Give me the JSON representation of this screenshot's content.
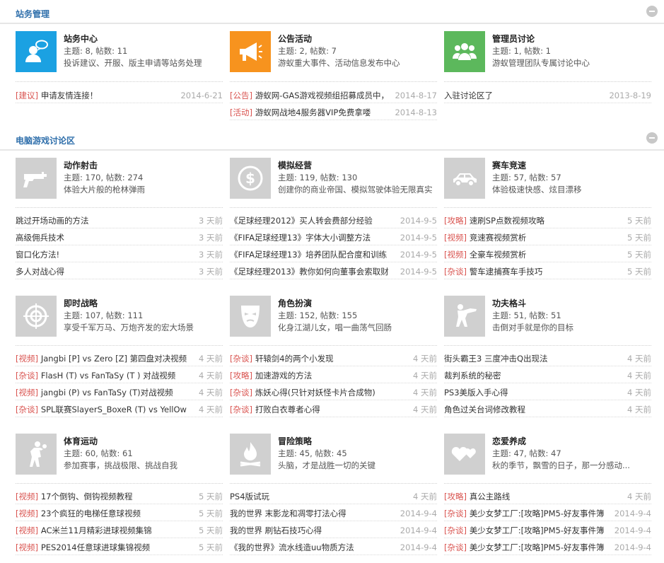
{
  "sections": [
    {
      "title": "站务管理"
    },
    {
      "title": "电脑游戏讨论区"
    }
  ],
  "forums": [
    {
      "name": "站务中心",
      "stats": "主题: 8, 帖数: 11",
      "desc": "投诉建议、开服、版主申请等站务处理",
      "icon": "user-chat-icon",
      "color": "#1ba1e2"
    },
    {
      "name": "公告活动",
      "stats": "主题: 2, 帖数: 7",
      "desc": "游蚁重大事件、活动信息发布中心",
      "icon": "megaphone-icon",
      "color": "#f7931e"
    },
    {
      "name": "管理员讨论",
      "stats": "主题: 1, 帖数: 1",
      "desc": "游蚁管理团队专属讨论中心",
      "icon": "group-icon",
      "color": "#5cb85c"
    },
    {
      "name": "动作射击",
      "stats": "主题: 170, 帖数: 274",
      "desc": "体验大片般的枪林弹雨",
      "icon": "gun-icon",
      "color": "#d0d0d0"
    },
    {
      "name": "模拟经营",
      "stats": "主题: 119, 帖数: 130",
      "desc": "创建你的商业帝国、模拟驾驶体验无限真实",
      "icon": "dollar-icon",
      "color": "#d0d0d0"
    },
    {
      "name": "赛车竞速",
      "stats": "主题: 57, 帖数: 57",
      "desc": "体验极速快感、炫目漂移",
      "icon": "car-icon",
      "color": "#d0d0d0"
    },
    {
      "name": "即时战略",
      "stats": "主题: 107, 帖数: 111",
      "desc": "享受千军万马、万炮齐发的宏大场景",
      "icon": "crosshair-icon",
      "color": "#d0d0d0"
    },
    {
      "name": "角色扮演",
      "stats": "主题: 152, 帖数: 155",
      "desc": "化身江湖儿女，唱一曲荡气回肠",
      "icon": "mask-icon",
      "color": "#d0d0d0"
    },
    {
      "name": "功夫格斗",
      "stats": "主题: 51, 帖数: 51",
      "desc": "击倒对手就是你的目标",
      "icon": "kick-icon",
      "color": "#d0d0d0"
    },
    {
      "name": "体育运动",
      "stats": "主题: 60, 帖数: 61",
      "desc": "参加赛事，挑战极限、挑战自我",
      "icon": "basketball-player-icon",
      "color": "#d0d0d0"
    },
    {
      "name": "冒险策略",
      "stats": "主题: 45, 帖数: 45",
      "desc": "头脑，才是战胜一切的关键",
      "icon": "campfire-icon",
      "color": "#d0d0d0"
    },
    {
      "name": "恋爱养成",
      "stats": "主题: 47, 帖数: 47",
      "desc": "秋的季节，飘雪的日子，那一分感动...",
      "icon": "hearts-icon",
      "color": "#d0d0d0"
    }
  ],
  "posts": [
    [
      {
        "tag": "[建议]",
        "title": "申请友情连接！",
        "date": "2014-6-21"
      }
    ],
    [
      {
        "tag": "[公告]",
        "title": "游蚁网-GAS游戏视频组招募成员中，",
        "date": "2014-8-17"
      },
      {
        "tag": "[活动]",
        "title": "游蚁网战地4服务器VIP免费拿喽",
        "date": "2014-8-13"
      }
    ],
    [
      {
        "tag": "",
        "title": "入驻讨论区了",
        "date": "2013-8-19"
      }
    ],
    [
      {
        "tag": "",
        "title": "跳过开场动画的方法",
        "date": "3 天前"
      },
      {
        "tag": "",
        "title": "高级佣兵技术",
        "date": "3 天前"
      },
      {
        "tag": "",
        "title": "窗口化方法!",
        "date": "3 天前"
      },
      {
        "tag": "",
        "title": "多人对战心得",
        "date": "3 天前"
      }
    ],
    [
      {
        "tag": "",
        "title": "《足球经理2012》买人转会费部分经验",
        "date": "2014-9-5"
      },
      {
        "tag": "",
        "title": "《FIFA足球经理13》字体大小调整方法",
        "date": "2014-9-5"
      },
      {
        "tag": "",
        "title": "《FIFA足球经理13》培养团队配合度和训练",
        "date": "2014-9-5"
      },
      {
        "tag": "",
        "title": "《足球经理2013》教你如何向董事会索取财",
        "date": "2014-9-5"
      }
    ],
    [
      {
        "tag": "[攻略]",
        "title": "速刷SP点数视频攻略",
        "date": "5 天前"
      },
      {
        "tag": "[视频]",
        "title": "竞速赛视频赏析",
        "date": "5 天前"
      },
      {
        "tag": "[视频]",
        "title": "全豪车视频赏析",
        "date": "5 天前"
      },
      {
        "tag": "[杂谈]",
        "title": "警车逮捕赛车手技巧",
        "date": "5 天前"
      }
    ],
    [
      {
        "tag": "[视频]",
        "title": "Jangbi [P] vs Zero [Z] 第四盘对决视频",
        "date": "4 天前"
      },
      {
        "tag": "[杂谈]",
        "title": "FlasH (T) vs FanTaSy (T ) 对战视频",
        "date": "4 天前"
      },
      {
        "tag": "[视频]",
        "title": "jangbi (P) vs FanTaSy (T)对战视频",
        "date": "4 天前"
      },
      {
        "tag": "[杂谈]",
        "title": "SPL联赛SlayerS_BoxeR (T) vs YellOw",
        "date": "4 天前"
      }
    ],
    [
      {
        "tag": "[杂谈]",
        "title": "轩辕剑4的两个小发现",
        "date": "4 天前"
      },
      {
        "tag": "[攻略]",
        "title": "加速游戏的方法",
        "date": "4 天前"
      },
      {
        "tag": "[杂谈]",
        "title": "炼妖心得(只针对妖怪卡片合成物)",
        "date": "4 天前"
      },
      {
        "tag": "[杂谈]",
        "title": "打败白衣尊者心得",
        "date": "4 天前"
      }
    ],
    [
      {
        "tag": "",
        "title": "街头霸王3 三度冲击Q出现法",
        "date": "4 天前"
      },
      {
        "tag": "",
        "title": "裁判系统的秘密",
        "date": "4 天前"
      },
      {
        "tag": "",
        "title": "PS3美版入手心得",
        "date": "4 天前"
      },
      {
        "tag": "",
        "title": "角色过关台词修改教程",
        "date": "4 天前"
      }
    ],
    [
      {
        "tag": "[视频]",
        "title": "17个倒钩、倒钩视频教程",
        "date": "5 天前"
      },
      {
        "tag": "[视频]",
        "title": "23个疯狂的电梯任意球视频",
        "date": "5 天前"
      },
      {
        "tag": "[视频]",
        "title": "AC米兰11月精彩进球视频集锦",
        "date": "5 天前"
      },
      {
        "tag": "[视频]",
        "title": "PES2014任意球进球集锦视频",
        "date": "5 天前"
      }
    ],
    [
      {
        "tag": "",
        "title": "PS4版试玩",
        "date": "4 天前"
      },
      {
        "tag": "",
        "title": "我的世界 末影龙和凋零打法心得",
        "date": "2014-9-4"
      },
      {
        "tag": "",
        "title": "我的世界 刷钻石技巧心得",
        "date": "2014-9-4"
      },
      {
        "tag": "",
        "title": "《我的世界》流水线造uu物质方法",
        "date": "2014-9-4"
      }
    ],
    [
      {
        "tag": "[攻略]",
        "title": "真公主路线",
        "date": "4 天前"
      },
      {
        "tag": "[杂谈]",
        "title": "美少女梦工厂:[攻略]PM5-好友事件簿",
        "date": "2014-9-4"
      },
      {
        "tag": "[杂谈]",
        "title": "美少女梦工厂:[攻略]PM5-好友事件簿",
        "date": "2014-9-4"
      },
      {
        "tag": "[杂谈]",
        "title": "美少女梦工厂:[攻略]PM5-好友事件簿",
        "date": "2014-9-4"
      }
    ]
  ]
}
